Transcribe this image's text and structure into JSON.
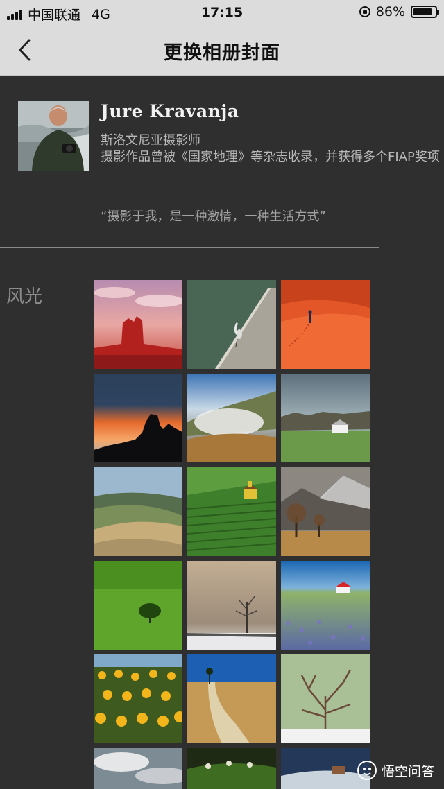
{
  "status_bar": {
    "carrier": "中国联通",
    "network": "4G",
    "time": "17:15",
    "battery": "86%",
    "battery_level": 0.86,
    "icons": [
      "signal-icon",
      "rotation-lock-icon",
      "battery-icon"
    ]
  },
  "nav": {
    "title": "更换相册封面",
    "back_icon": "chevron-left-icon"
  },
  "profile": {
    "name": "Jure Kravanja",
    "bio_line1": "斯洛文尼亚摄影师",
    "bio_line2": "摄影作品曾被《国家地理》等杂志收录，并获得多个FIAP奖项",
    "quote": "“摄影于我，是一种激情，一种生活方式”"
  },
  "gallery": {
    "category": "风光",
    "photos": [
      "red-butte-desert",
      "heron-on-boardwalk",
      "orange-sand-dunes",
      "sunset-rock-silhouette",
      "misty-valley",
      "farmhouse-meadow",
      "rolling-hills",
      "vineyard-chapel",
      "autumn-trees-mountains",
      "lone-tree-green-field",
      "foggy-tree-snow",
      "lavender-field-house",
      "sunflower-field",
      "country-road-tree",
      "bare-tree-snow",
      "cloudy-sky",
      "green-hills-trees",
      "winter-village"
    ]
  },
  "watermark": {
    "text": "悟空问答",
    "icon": "wukong-logo-icon"
  }
}
